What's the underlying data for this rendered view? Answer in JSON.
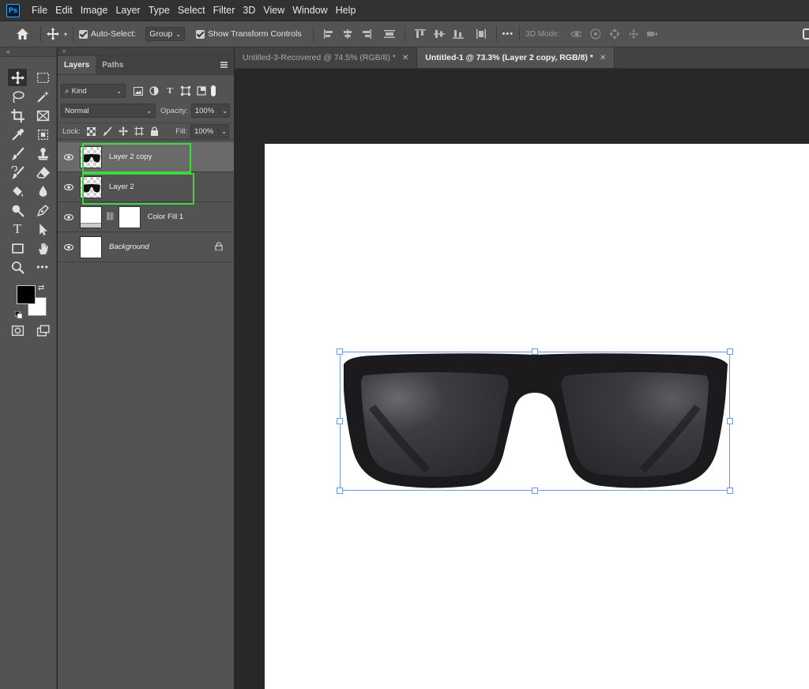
{
  "app": {
    "logo": "Ps"
  },
  "menu": [
    "File",
    "Edit",
    "Image",
    "Layer",
    "Type",
    "Select",
    "Filter",
    "3D",
    "View",
    "Window",
    "Help"
  ],
  "options_bar": {
    "auto_select_label": "Auto-Select:",
    "auto_select_value": "Group",
    "show_transform_label": "Show Transform Controls",
    "more": "•••",
    "mode_label": "3D Mode:"
  },
  "toolbar": {
    "foreground_color": "#000000",
    "background_color": "#ffffff"
  },
  "layers_panel": {
    "tabs": [
      "Layers",
      "Paths"
    ],
    "filter_kind": "Kind",
    "blend_mode": "Normal",
    "opacity_label": "Opacity:",
    "opacity_value": "100%",
    "lock_label": "Lock:",
    "fill_label": "Fill:",
    "fill_value": "100%",
    "layers": [
      {
        "name": "Layer 2 copy",
        "selected": true,
        "highlighted": true
      },
      {
        "name": "Layer 2",
        "selected": false,
        "highlighted": true
      },
      {
        "name": "Color Fill 1",
        "selected": false
      },
      {
        "name": "Background",
        "selected": false,
        "locked": true
      }
    ]
  },
  "documents": {
    "tabs": [
      {
        "title": "Untitled-3-Recovered @ 74.5% (RGB/8) *",
        "active": false
      },
      {
        "title": "Untitled-1 @ 73.3% (Layer 2 copy, RGB/8) *",
        "active": true
      }
    ]
  },
  "colors": {
    "highlight": "#3cd83c",
    "transform_box": "#6d9ae0",
    "ps_blue": "#31a8ff"
  }
}
